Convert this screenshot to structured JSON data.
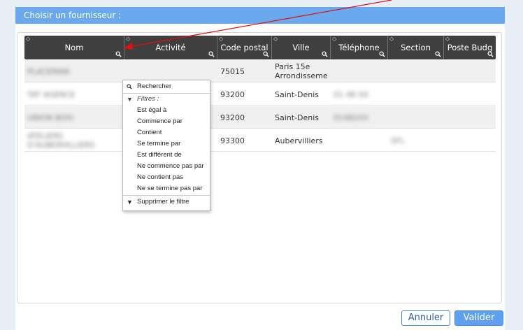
{
  "dialog": {
    "title": "Choisir un fournisseur :"
  },
  "table": {
    "columns": [
      {
        "label": "Nom"
      },
      {
        "label": "Activité"
      },
      {
        "label": "Code postal"
      },
      {
        "label": "Ville"
      },
      {
        "label": "Téléphone"
      },
      {
        "label": "Section"
      },
      {
        "label": "Poste Budg"
      }
    ],
    "rows": [
      {
        "nom": "PLACEMAN",
        "code_postal": "75015",
        "ville": "Paris 15e Arrondisseme",
        "telephone": "",
        "section": ""
      },
      {
        "nom": "TAT AGENCE",
        "code_postal": "93200",
        "ville": "Saint-Denis",
        "telephone": "01 48 XX",
        "section": ""
      },
      {
        "nom": "UNION BOIS",
        "code_postal": "93200",
        "ville": "Saint-Denis",
        "telephone": "01482XX",
        "section": ""
      },
      {
        "nom": "ATELIERS D'AUBERVILLIERS",
        "code_postal": "93300",
        "ville": "Aubervilliers",
        "telephone": "",
        "section": "SFL"
      }
    ]
  },
  "filter_menu": {
    "search": "Rechercher",
    "filters_header": "Filtres :",
    "options": [
      "Est égal à",
      "Commence par",
      "Contient",
      "Se termine par",
      "Est différent de",
      "Ne commence pas par",
      "Ne contient pas",
      "Ne se termine pas par"
    ],
    "remove": "Supprimer le filtre"
  },
  "buttons": {
    "cancel": "Annuler",
    "ok": "Valider"
  },
  "colors": {
    "title_bar": "#6aa9ee",
    "header_bg": "#3f3f3f",
    "annotation_arrow": "#e01010"
  }
}
